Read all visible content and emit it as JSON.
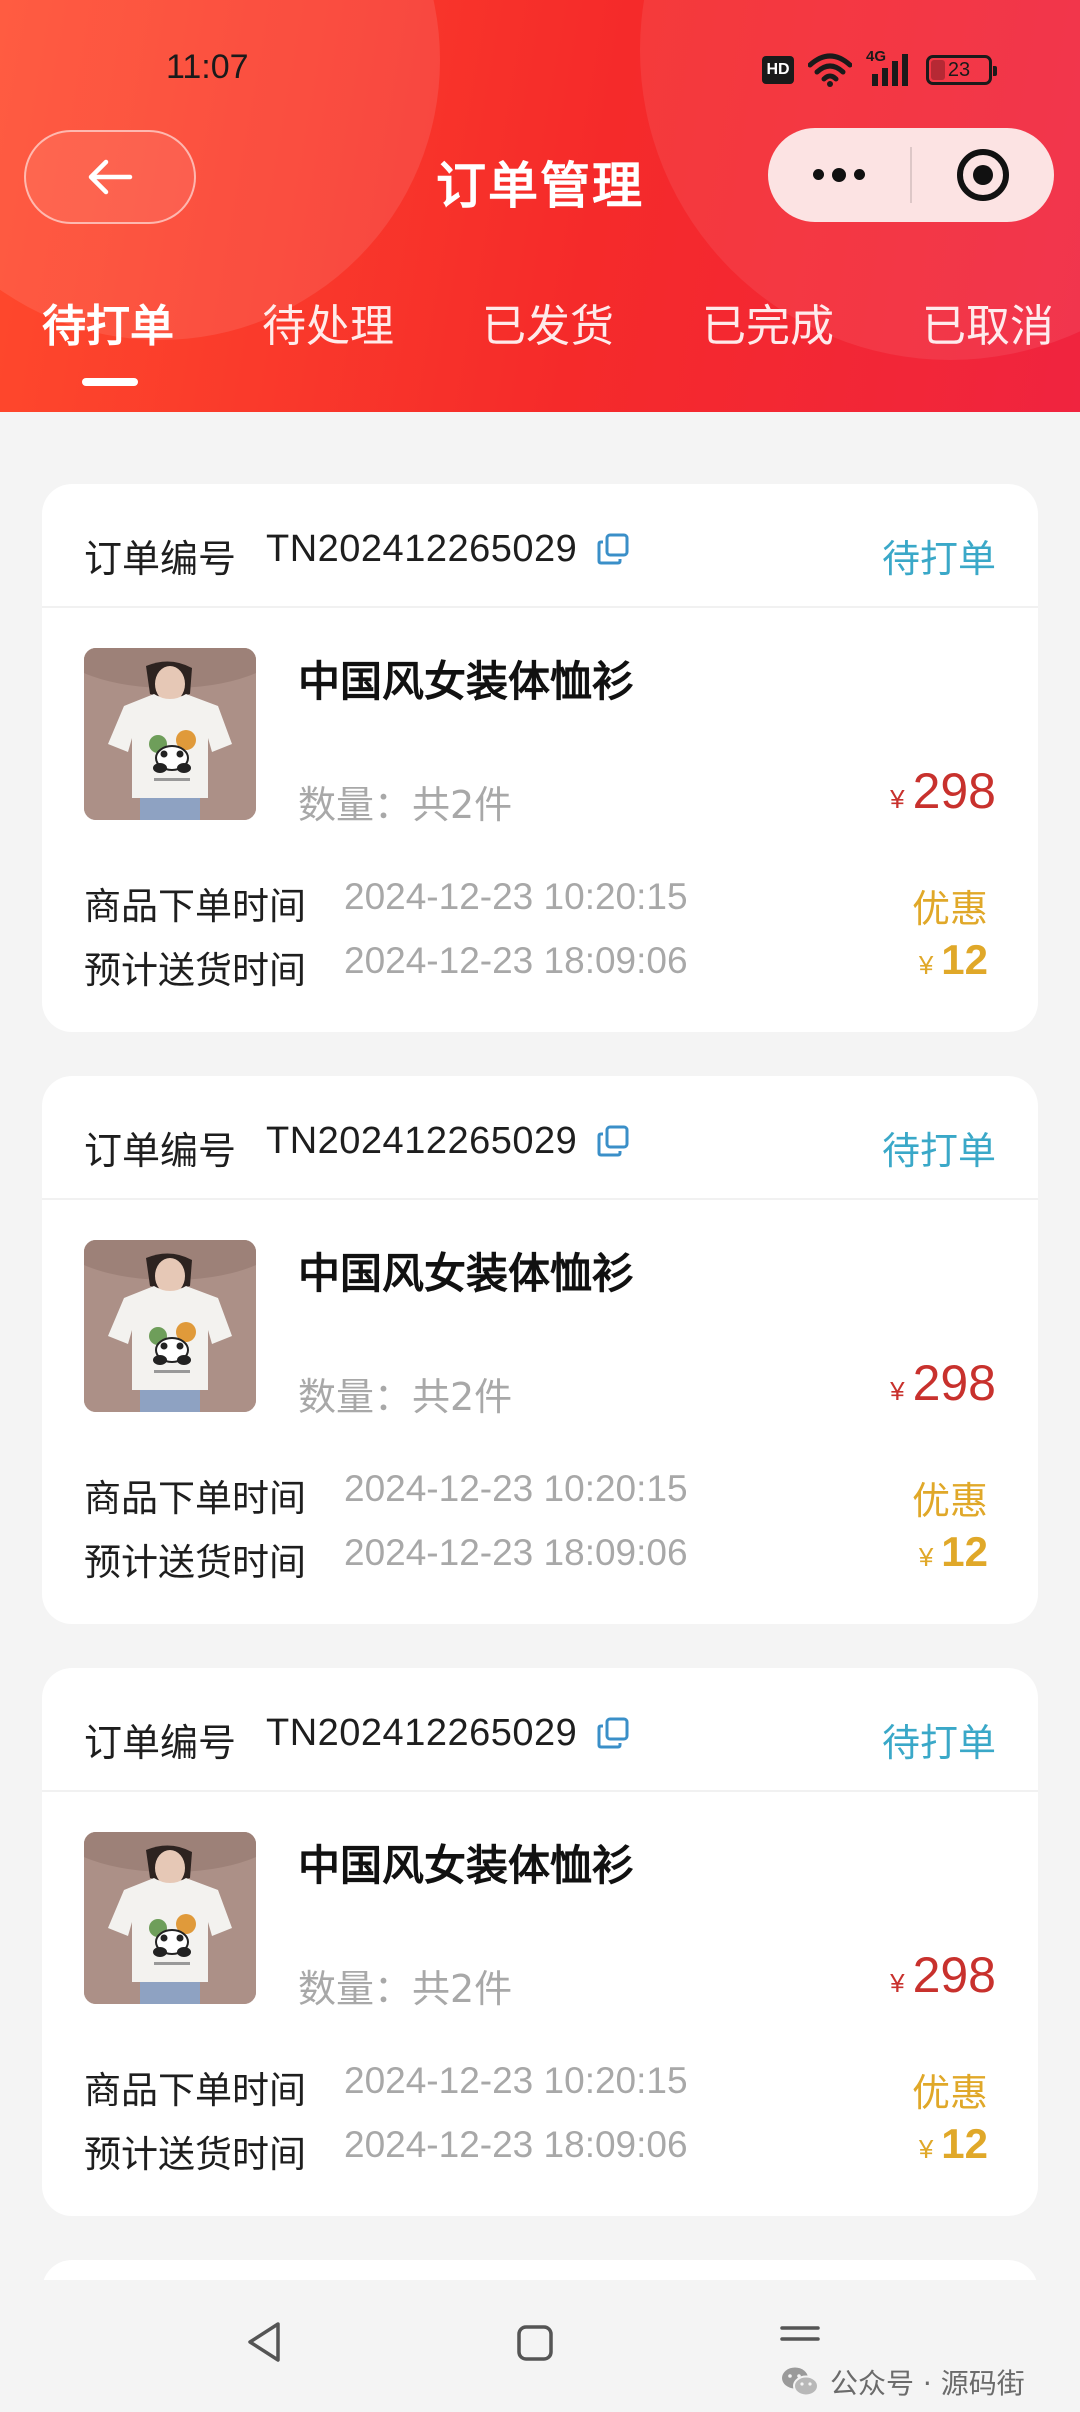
{
  "status_bar": {
    "time": "11:07",
    "hd": "HD",
    "network": "4G",
    "battery": "23",
    "battery_level_percent": 23
  },
  "nav": {
    "title": "订单管理"
  },
  "tabs": [
    {
      "label": "待打单",
      "active": true
    },
    {
      "label": "待处理",
      "active": false
    },
    {
      "label": "已发货",
      "active": false
    },
    {
      "label": "已完成",
      "active": false
    },
    {
      "label": "已取消",
      "active": false
    }
  ],
  "orders": [
    {
      "order_label": "订单编号",
      "order_no": "TN202412265029",
      "status": "待打单",
      "product_name": "中国风女装体恤衫",
      "quantity": "数量：共2件",
      "currency": "¥",
      "price": "298",
      "order_time_label": "商品下单时间",
      "order_time": "2024-12-23 10:20:15",
      "delivery_time_label": "预计送货时间",
      "delivery_time": "2024-12-23 18:09:06",
      "discount_label": "优惠",
      "discount": "12"
    },
    {
      "order_label": "订单编号",
      "order_no": "TN202412265029",
      "status": "待打单",
      "product_name": "中国风女装体恤衫",
      "quantity": "数量：共2件",
      "currency": "¥",
      "price": "298",
      "order_time_label": "商品下单时间",
      "order_time": "2024-12-23 10:20:15",
      "delivery_time_label": "预计送货时间",
      "delivery_time": "2024-12-23 18:09:06",
      "discount_label": "优惠",
      "discount": "12"
    },
    {
      "order_label": "订单编号",
      "order_no": "TN202412265029",
      "status": "待打单",
      "product_name": "中国风女装体恤衫",
      "quantity": "数量：共2件",
      "currency": "¥",
      "price": "298",
      "order_time_label": "商品下单时间",
      "order_time": "2024-12-23 10:20:15",
      "delivery_time_label": "预计送货时间",
      "delivery_time": "2024-12-23 18:09:06",
      "discount_label": "优惠",
      "discount": "12"
    }
  ],
  "watermark": "公众号 · 源码街",
  "colors": {
    "header_start": "#ff4a2c",
    "header_end": "#f0243f",
    "status_teal": "#3aa8c8",
    "price_red": "#c8312d",
    "discount_gold": "#e0a829"
  },
  "icons": {
    "back": "arrow-left-icon",
    "more": "more-dots-icon",
    "close": "target-circle-icon",
    "copy": "copy-icon",
    "wifi": "wifi-icon",
    "signal": "signal-icon"
  }
}
